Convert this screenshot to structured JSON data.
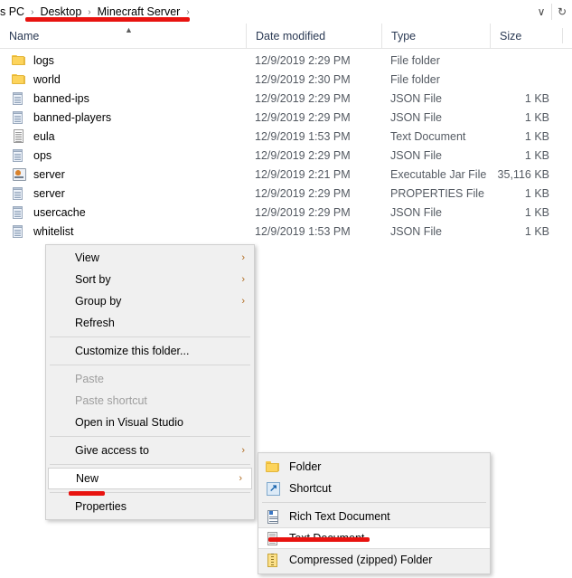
{
  "address_bar": {
    "crumbs": [
      {
        "label": "s PC",
        "clipped": true
      },
      {
        "label": "Desktop",
        "clipped": false
      },
      {
        "label": "Minecraft Server",
        "clipped": false
      }
    ],
    "separator": "›",
    "dropdown_icon": "chevron-down-icon",
    "refresh_icon": "refresh-icon",
    "dropdown_glyph": "∨",
    "refresh_glyph": "↻",
    "highlight_color": "#e8130f"
  },
  "columns": {
    "name": "Name",
    "date_modified": "Date modified",
    "type": "Type",
    "size": "Size",
    "sort_caret": "▲"
  },
  "files": [
    {
      "name": "logs",
      "icon": "folder-icon",
      "date": "12/9/2019 2:29 PM",
      "type": "File folder",
      "size": ""
    },
    {
      "name": "world",
      "icon": "folder-icon",
      "date": "12/9/2019 2:30 PM",
      "type": "File folder",
      "size": ""
    },
    {
      "name": "banned-ips",
      "icon": "json-file-icon",
      "date": "12/9/2019 2:29 PM",
      "type": "JSON File",
      "size": "1 KB"
    },
    {
      "name": "banned-players",
      "icon": "json-file-icon",
      "date": "12/9/2019 2:29 PM",
      "type": "JSON File",
      "size": "1 KB"
    },
    {
      "name": "eula",
      "icon": "text-file-icon",
      "date": "12/9/2019 1:53 PM",
      "type": "Text Document",
      "size": "1 KB"
    },
    {
      "name": "ops",
      "icon": "json-file-icon",
      "date": "12/9/2019 2:29 PM",
      "type": "JSON File",
      "size": "1 KB"
    },
    {
      "name": "server",
      "icon": "jar-file-icon",
      "date": "12/9/2019 2:21 PM",
      "type": "Executable Jar File",
      "size": "35,116 KB"
    },
    {
      "name": "server",
      "icon": "json-file-icon",
      "date": "12/9/2019 2:29 PM",
      "type": "PROPERTIES File",
      "size": "1 KB"
    },
    {
      "name": "usercache",
      "icon": "json-file-icon",
      "date": "12/9/2019 2:29 PM",
      "type": "JSON File",
      "size": "1 KB"
    },
    {
      "name": "whitelist",
      "icon": "json-file-icon",
      "date": "12/9/2019 1:53 PM",
      "type": "JSON File",
      "size": "1 KB"
    }
  ],
  "context_menu": {
    "items": [
      {
        "label": "View",
        "submenu": true,
        "disabled": false,
        "hovered": false
      },
      {
        "label": "Sort by",
        "submenu": true,
        "disabled": false,
        "hovered": false
      },
      {
        "label": "Group by",
        "submenu": true,
        "disabled": false,
        "hovered": false
      },
      {
        "label": "Refresh",
        "submenu": false,
        "disabled": false,
        "hovered": false
      },
      {
        "separator": true
      },
      {
        "label": "Customize this folder...",
        "submenu": false,
        "disabled": false,
        "hovered": false
      },
      {
        "separator": true
      },
      {
        "label": "Paste",
        "submenu": false,
        "disabled": true,
        "hovered": false
      },
      {
        "label": "Paste shortcut",
        "submenu": false,
        "disabled": true,
        "hovered": false
      },
      {
        "label": "Open in Visual Studio",
        "submenu": false,
        "disabled": false,
        "hovered": false
      },
      {
        "separator": true
      },
      {
        "label": "Give access to",
        "submenu": true,
        "disabled": false,
        "hovered": false
      },
      {
        "separator": true
      },
      {
        "label": "New",
        "submenu": true,
        "disabled": false,
        "hovered": true
      },
      {
        "separator": true
      },
      {
        "label": "Properties",
        "submenu": false,
        "disabled": false,
        "hovered": false
      }
    ],
    "submenu_arrow": "›"
  },
  "new_submenu": {
    "items": [
      {
        "label": "Folder",
        "icon": "folder-icon",
        "hovered": false
      },
      {
        "label": "Shortcut",
        "icon": "shortcut-icon",
        "hovered": false
      },
      {
        "separator": true
      },
      {
        "label": "Rich Text Document",
        "icon": "rich-text-icon",
        "hovered": false
      },
      {
        "label": "Text Document",
        "icon": "text-file-icon",
        "hovered": true
      },
      {
        "label": "Compressed (zipped) Folder",
        "icon": "zip-folder-icon",
        "hovered": false
      }
    ]
  },
  "annotations": {
    "breadcrumb_underline": "Desktop › Minecraft Server",
    "new_underline": "New",
    "text_document_underline": "Text Document",
    "color": "#e8130f"
  }
}
